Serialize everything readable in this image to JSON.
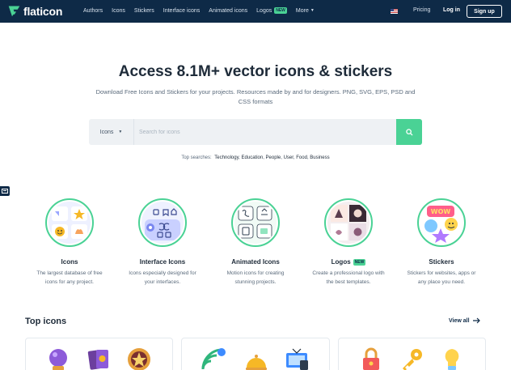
{
  "header": {
    "logo_text": "flaticon",
    "nav": [
      {
        "label": "Authors"
      },
      {
        "label": "Icons"
      },
      {
        "label": "Stickers"
      },
      {
        "label": "Interface icons"
      },
      {
        "label": "Animated icons"
      },
      {
        "label": "Logos",
        "badge": "NEW"
      },
      {
        "label": "More"
      }
    ],
    "pricing": "Pricing",
    "login": "Log in",
    "signup": "Sign up"
  },
  "hero": {
    "title": "Access 8.1M+ vector icons & stickers",
    "subtitle": "Download Free Icons and Stickers for your projects. Resources made by and for designers. PNG, SVG, EPS, PSD and CSS formats",
    "search": {
      "type_label": "Icons",
      "placeholder": "Search for icons"
    },
    "top_searches_label": "Top searches:",
    "top_searches": [
      "Technology",
      "Education",
      "People",
      "User",
      "Food",
      "Business"
    ]
  },
  "categories": [
    {
      "title": "Icons",
      "desc": "The largest database of free icons for any project."
    },
    {
      "title": "Interface Icons",
      "desc": "Icons especially designed for your interfaces."
    },
    {
      "title": "Animated Icons",
      "desc": "Motion icons for creating stunning projects."
    },
    {
      "title": "Logos",
      "badge": "NEW",
      "desc": "Create a professional logo with the best templates."
    },
    {
      "title": "Stickers",
      "desc": "Stickers for websites, apps or any place you need."
    }
  ],
  "top_icons": {
    "title": "Top icons",
    "view_all": "View all"
  },
  "colors": {
    "navy": "#0e2a47",
    "accent_green": "#4ad295",
    "text_dark": "#1e2b39",
    "text_muted": "#5b6b7c"
  }
}
